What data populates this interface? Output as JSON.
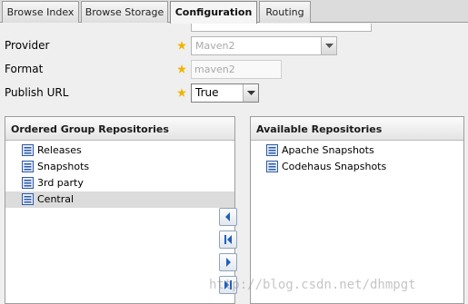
{
  "tabs": [
    {
      "label": "Browse Index"
    },
    {
      "label": "Browse Storage"
    },
    {
      "label": "Configuration"
    },
    {
      "label": "Routing"
    }
  ],
  "form": {
    "provider": {
      "label": "Provider",
      "value": "Maven2"
    },
    "format": {
      "label": "Format",
      "value": "maven2"
    },
    "publish_url": {
      "label": "Publish URL",
      "value": "True"
    }
  },
  "ordered_group": {
    "title": "Ordered Group Repositories",
    "items": [
      {
        "label": "Releases"
      },
      {
        "label": "Snapshots"
      },
      {
        "label": "3rd party"
      },
      {
        "label": "Central"
      }
    ],
    "selected": "Central"
  },
  "available": {
    "title": "Available Repositories",
    "items": [
      {
        "label": "Apache Snapshots"
      },
      {
        "label": "Codehaus Snapshots"
      }
    ]
  },
  "colors": {
    "required_star": "#f0b400",
    "button_arrow": "#1f5fbf",
    "repo_icon": "#2c5aa8"
  },
  "watermark": "http://blog.csdn.net/dhmpgt"
}
